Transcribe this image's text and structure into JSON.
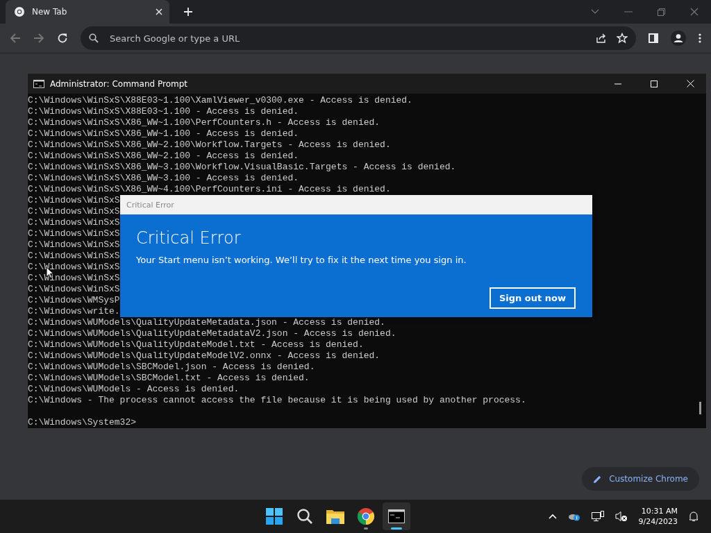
{
  "browser": {
    "tab": {
      "title": "New Tab",
      "selected": true
    },
    "address": {
      "placeholder": "Search Google or type a URL"
    },
    "customize_button": "Customize Chrome"
  },
  "cmd_window": {
    "title": "Administrator: Command Prompt",
    "lines": [
      "C:\\Windows\\WinSxS\\X88E03~1.100\\XamlViewer_v0300.exe - Access is denied.",
      "C:\\Windows\\WinSxS\\X88E03~1.100 - Access is denied.",
      "C:\\Windows\\WinSxS\\X86_WW~1.100\\PerfCounters.h - Access is denied.",
      "C:\\Windows\\WinSxS\\X86_WW~1.100 - Access is denied.",
      "C:\\Windows\\WinSxS\\X86_WW~2.100\\Workflow.Targets - Access is denied.",
      "C:\\Windows\\WinSxS\\X86_WW~2.100 - Access is denied.",
      "C:\\Windows\\WinSxS\\X86_WW~3.100\\Workflow.VisualBasic.Targets - Access is denied.",
      "C:\\Windows\\WinSxS\\X86_WW~3.100 - Access is denied.",
      "C:\\Windows\\WinSxS\\X86_WW~4.100\\PerfCounters.ini - Access is denied.",
      "C:\\Windows\\WinSxS",
      "C:\\Windows\\WinSxS",
      "C:\\Windows\\WinSxS",
      "C:\\Windows\\WinSxS",
      "C:\\Windows\\WinSxS",
      "C:\\Windows\\WinSxS",
      "C:\\Windows\\WinSxS",
      "C:\\Windows\\WinSxS",
      "C:\\Windows\\WinSxS",
      "C:\\Windows\\WMSysP",
      "C:\\Windows\\write.",
      "C:\\Windows\\WUModels\\QualityUpdateMetadata.json - Access is denied.",
      "C:\\Windows\\WUModels\\QualityUpdateMetadataV2.json - Access is denied.",
      "C:\\Windows\\WUModels\\QualityUpdateModel.txt - Access is denied.",
      "C:\\Windows\\WUModels\\QualityUpdateModelV2.onnx - Access is denied.",
      "C:\\Windows\\WUModels\\SBCModel.json - Access is denied.",
      "C:\\Windows\\WUModels\\SBCModel.txt - Access is denied.",
      "C:\\Windows\\WUModels - Access is denied.",
      "C:\\Windows - The process cannot access the file because it is being used by another process."
    ],
    "prompt": "C:\\Windows\\System32>"
  },
  "dialog": {
    "caption": "Critical Error",
    "heading": "Critical Error",
    "message": "Your Start menu isn’t working. We’ll try to fix it the next time you sign in.",
    "button": "Sign out now"
  },
  "taskbar": {
    "apps": [
      {
        "kind": "start",
        "selected": false,
        "running": false
      },
      {
        "kind": "search",
        "selected": false,
        "running": false
      },
      {
        "kind": "files",
        "selected": false,
        "running": false
      },
      {
        "kind": "chrome",
        "selected": false,
        "running": true
      },
      {
        "kind": "terminal",
        "selected": true,
        "running": true
      }
    ],
    "time": "10:31 AM",
    "date": "9/24/2023"
  }
}
